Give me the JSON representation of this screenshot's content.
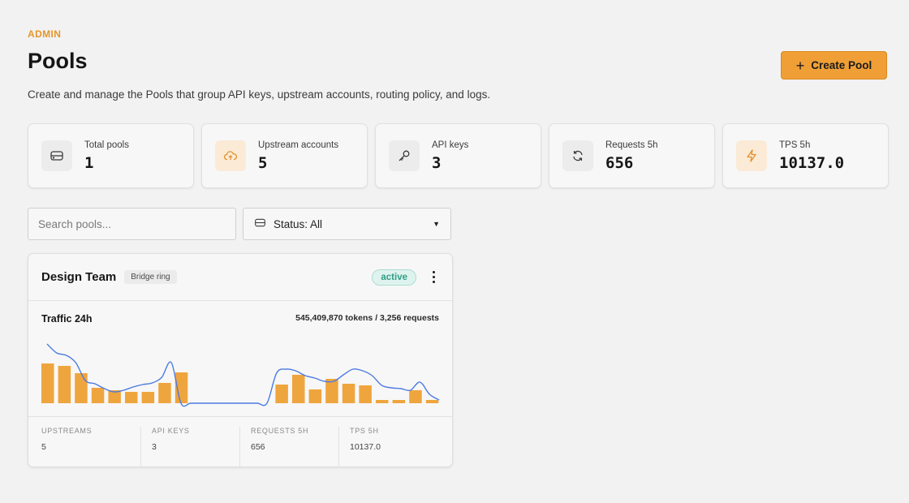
{
  "header": {
    "eyebrow": "ADMIN",
    "title": "Pools",
    "subtitle": "Create and manage the Pools that group API keys, upstream accounts, routing policy, and logs.",
    "create_button": "Create Pool"
  },
  "stats": [
    {
      "label": "Total pools",
      "value": "1",
      "icon": "database-icon"
    },
    {
      "label": "Upstream accounts",
      "value": "5",
      "icon": "cloud-upload-icon"
    },
    {
      "label": "API keys",
      "value": "3",
      "icon": "key-icon"
    },
    {
      "label": "Requests 5h",
      "value": "656",
      "icon": "refresh-icon"
    },
    {
      "label": "TPS 5h",
      "value": "10137.0",
      "icon": "lightning-icon"
    }
  ],
  "filters": {
    "search_placeholder": "Search pools...",
    "status_label": "Status: All"
  },
  "pool": {
    "name": "Design Team",
    "tag": "Bridge ring",
    "status": "active",
    "traffic_label": "Traffic 24h",
    "traffic_summary": "545,409,870 tokens / 3,256 requests",
    "stats": [
      {
        "label": "UPSTREAMS",
        "value": "5"
      },
      {
        "label": "API KEYS",
        "value": "3"
      },
      {
        "label": "REQUESTS 5H",
        "value": "656"
      },
      {
        "label": "TPS 5H",
        "value": "10137.0"
      }
    ]
  },
  "chart_data": {
    "type": "bar",
    "bars": [
      49,
      46,
      37,
      19,
      16,
      14,
      14,
      25,
      38,
      0,
      0,
      0,
      0,
      0,
      23,
      35,
      17,
      30,
      24,
      22,
      4,
      4,
      16,
      4
    ],
    "line": [
      73,
      62,
      59,
      50,
      28,
      24,
      18,
      14,
      16,
      20,
      23,
      25,
      32,
      50,
      0,
      0,
      0,
      0,
      0,
      0,
      0,
      0,
      0,
      0,
      37,
      42,
      40,
      34,
      31,
      27,
      27,
      35,
      42,
      40,
      34,
      22,
      19,
      18,
      16,
      26,
      11,
      4
    ],
    "colors": {
      "bar": "#efa53d",
      "line": "#4b7be0"
    }
  },
  "colors": {
    "accent": "#ef9f36",
    "eyebrow": "#e8962a",
    "active": "#2f9e85"
  }
}
